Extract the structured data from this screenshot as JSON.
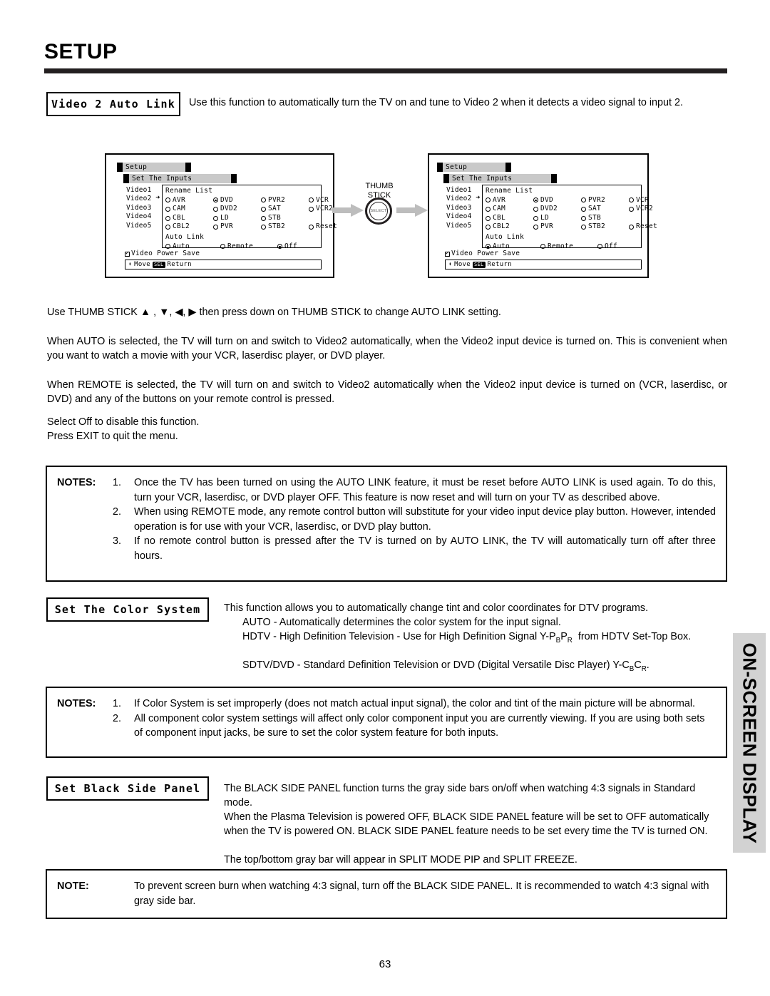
{
  "page": {
    "title": "SETUP",
    "number": "63",
    "side_tab": "ON-SCREEN DISPLAY"
  },
  "sections": {
    "video2_auto_link": {
      "label": "Video 2 Auto Link",
      "description": "Use this function to automatically turn the TV on and tune to Video 2 when it detects a video signal to input 2.",
      "paragraphs": [
        "Use THUMB STICK ▲ , ▼, ◀, ▶ then press down on THUMB STICK to change AUTO LINK setting.",
        "When AUTO  is selected, the TV will turn on and switch to Video2 automatically, when the Video2 input device is turned on. This is convenient when you want to watch a movie with your VCR, laserdisc player, or DVD player.",
        "When REMOTE is selected, the TV will turn on and switch to Video2 automatically when the Video2 input device is turned on (VCR, laserdisc, or DVD) and any of the buttons on your remote control is pressed.",
        "Select Off to disable this function.",
        "Press EXIT to quit the menu."
      ]
    },
    "color_system": {
      "label": "Set The Color System",
      "lines": [
        "This function allows you to automatically change tint and color coordinates for DTV programs.",
        "AUTO - Automatically determines the color system for the input signal.",
        "HDTV - High Definition Television - Use for High Definition Signal Y-PBPR  from HDTV Set-Top Box.",
        "SDTV/DVD - Standard Definition Television or DVD (Digital Versatile Disc Player) Y-CBCR."
      ]
    },
    "black_side_panel": {
      "label": "Set Black Side Panel",
      "lines": [
        "The BLACK SIDE PANEL function turns the gray side bars on/off when watching 4:3 signals in Standard mode.",
        "When the Plasma Television is powered OFF, BLACK SIDE PANEL feature will be set to OFF automatically when the TV is powered ON.  BLACK SIDE PANEL feature needs to be set every time the TV is turned ON.",
        "The top/bottom gray bar will appear in SPLIT MODE PIP and SPLIT FREEZE."
      ]
    }
  },
  "notes_boxes": [
    {
      "heading": "NOTES:",
      "items": [
        "Once the TV has been turned on using the AUTO LINK feature, it must be reset before AUTO LINK is used again. To do this, turn your VCR, laserdisc, or DVD player OFF. This feature is now reset and will turn on your TV as described above.",
        "When using REMOTE mode, any remote control button will substitute for your video input device play button. However, intended operation is for use with your VCR, laserdisc, or DVD play button.",
        "If no remote control button is pressed after the TV is turned on by AUTO LINK, the TV will automatically turn off after three hours."
      ],
      "numbers": [
        "1.",
        "2.",
        "3."
      ]
    },
    {
      "heading": "NOTES:",
      "items": [
        "If Color System is set improperly (does not match actual input signal), the color and tint of the main picture will be abnormal.",
        "All component color system settings will affect only color component input you are currently viewing.  If you are using both sets of component input jacks, be sure to set the color system feature for both inputs."
      ],
      "numbers": [
        "1.",
        "2."
      ]
    },
    {
      "heading": "NOTE:",
      "items": [
        "To prevent screen burn when watching 4:3 signal, turn off the BLACK SIDE PANEL.  It is recommended to watch 4:3 signal with gray side bar."
      ],
      "numbers": [
        ""
      ]
    }
  ],
  "osd": {
    "menu_title": "Setup",
    "submenu_title": "Set The Inputs",
    "inputs": [
      "Video1",
      "Video2",
      "Video3",
      "Video4",
      "Video5"
    ],
    "selected_input_index": 1,
    "selected_input_marker": "➜",
    "rename_list_label": "Rename List",
    "rename_options": [
      "AVR",
      "DVD",
      "PVR2",
      "VCR",
      "CAM",
      "DVD2",
      "SAT",
      "VCR2",
      "CBL",
      "LD",
      "STB",
      "",
      "CBL2",
      "PVR",
      "STB2",
      "Reset"
    ],
    "rename_selected": "DVD",
    "auto_link_label": "Auto Link",
    "auto_link_options": [
      "Auto",
      "Remote",
      "Off"
    ],
    "power_save_label": "Video Power Save",
    "power_save_checked": true,
    "footer_move": "Move",
    "footer_sel": "SEL",
    "footer_return": "Return",
    "left_screen_autolink_selected": "Off",
    "right_screen_autolink_selected": "Auto"
  },
  "thumb_stick": {
    "line1": "THUMB",
    "line2": "STICK",
    "button_label": "SELECT"
  }
}
